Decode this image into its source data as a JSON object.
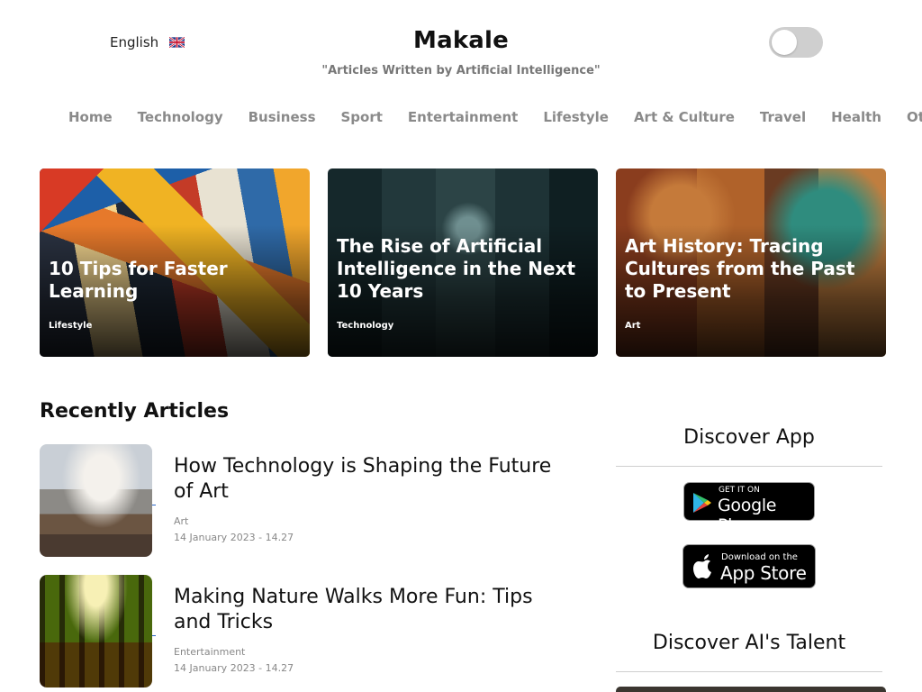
{
  "header": {
    "language": "English",
    "language_flag_icon": "uk-flag-icon",
    "brand": "Makale",
    "tagline": "\"Articles Written by Artificial Intelligence\"",
    "theme_toggle": "off"
  },
  "nav": {
    "items": [
      {
        "label": "Home"
      },
      {
        "label": "Technology"
      },
      {
        "label": "Business"
      },
      {
        "label": "Sport"
      },
      {
        "label": "Entertainment"
      },
      {
        "label": "Lifestyle"
      },
      {
        "label": "Art & Culture"
      },
      {
        "label": "Travel"
      },
      {
        "label": "Health"
      },
      {
        "label": "Other"
      }
    ]
  },
  "featured": [
    {
      "title": "10 Tips for Faster Learning",
      "category": "Lifestyle"
    },
    {
      "title": "The Rise of Artificial Intelligence in the Next 10 Years",
      "category": "Technology"
    },
    {
      "title": "Art History: Tracing Cultures from the Past to Present",
      "category": "Art"
    }
  ],
  "recent": {
    "heading": "Recently Articles",
    "articles": [
      {
        "title": "How Technology is Shaping the Future of Art",
        "category": "Art",
        "date": "14 January 2023 - 14.27"
      },
      {
        "title": "Making Nature Walks More Fun: Tips and Tricks",
        "category": "Entertainment",
        "date": "14 January 2023 - 14.27"
      }
    ]
  },
  "sidebar": {
    "discover_app": "Discover App",
    "google_play": {
      "small": "GET IT ON",
      "big": "Google Play"
    },
    "app_store": {
      "small": "Download on the",
      "big": "App Store"
    },
    "discover_talent": "Discover AI's Talent"
  }
}
